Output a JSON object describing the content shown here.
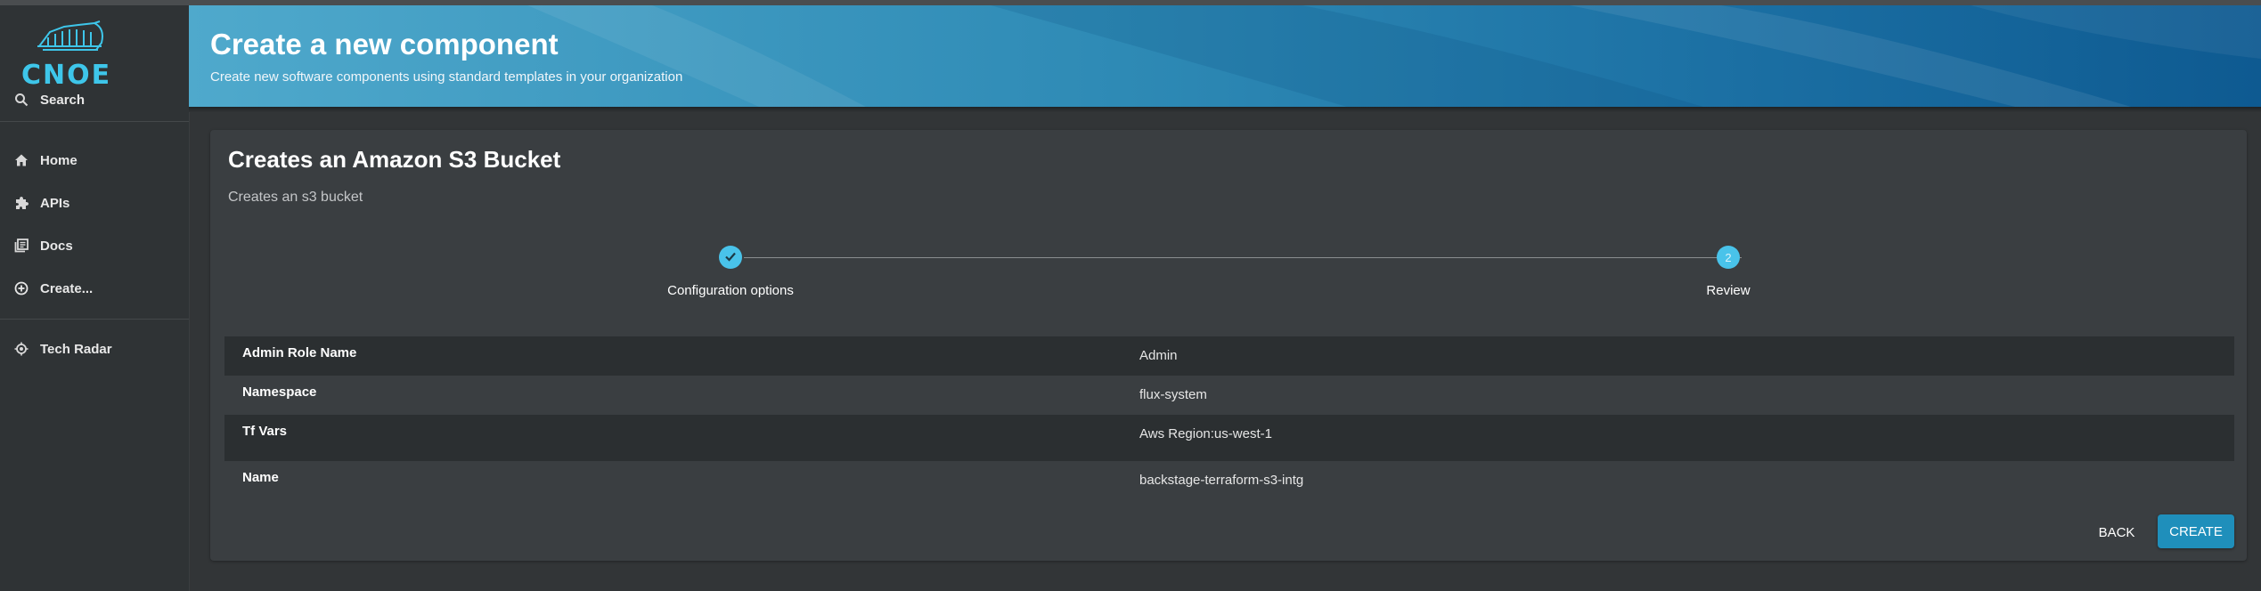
{
  "sidebar": {
    "logo": {
      "text": "CNOE",
      "color": "#3ec6ea"
    },
    "search_label": "Search",
    "items": [
      {
        "label": "Home",
        "icon": "home-icon"
      },
      {
        "label": "APIs",
        "icon": "puzzle-icon"
      },
      {
        "label": "Docs",
        "icon": "library-icon"
      },
      {
        "label": "Create...",
        "icon": "add-circle-icon"
      },
      {
        "label": "Tech Radar",
        "icon": "radar-icon"
      }
    ]
  },
  "header": {
    "title": "Create a new component",
    "subtitle": "Create new software components using standard templates in your organization"
  },
  "card": {
    "title": "Creates an Amazon S3 Bucket",
    "description": "Creates an s3 bucket",
    "steps": [
      {
        "label": "Configuration options",
        "state": "completed",
        "icon": "check-icon"
      },
      {
        "label": "Review",
        "state": "active",
        "number": "2"
      }
    ],
    "review_rows": [
      {
        "key": "Admin Role Name",
        "value": "Admin"
      },
      {
        "key": "Namespace",
        "value": "flux-system"
      },
      {
        "key": "Tf Vars",
        "value": "Aws Region:us-west-1"
      },
      {
        "key": "Name",
        "value": "backstage-terraform-s3-intg"
      }
    ],
    "back_label": "BACK",
    "create_label": "CREATE"
  },
  "colors": {
    "accent": "#49c3ea",
    "primary_button": "#1f8fbb",
    "sidebar_bg": "#2f3335",
    "page_bg": "#323537"
  }
}
